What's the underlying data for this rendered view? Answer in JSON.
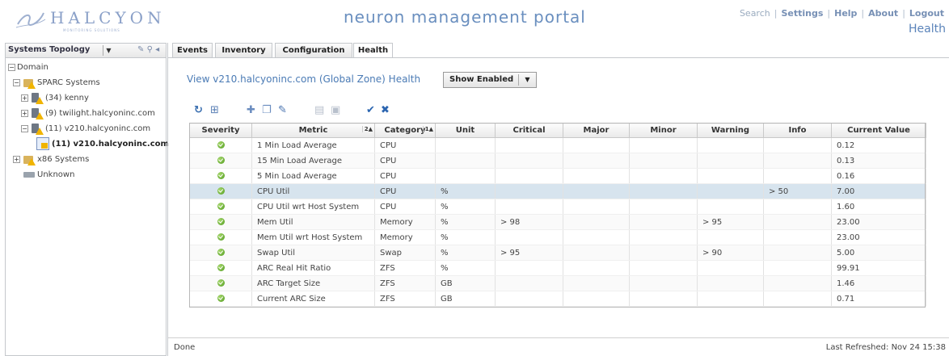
{
  "header": {
    "logo_text": "HALCYON",
    "logo_sub": "MONITORING SOLUTIONS",
    "portal_title": "neuron management portal",
    "links": [
      "Search",
      "Settings",
      "Help",
      "About",
      "Logout"
    ],
    "page_label": "Health",
    "colors": {
      "title": "#6a8fbf",
      "links": "#7790b5"
    }
  },
  "sidebar": {
    "title": "Systems Topology",
    "tree": [
      {
        "label": "Domain",
        "toggle": "⊟",
        "icon": "none"
      },
      {
        "label": "SPARC Systems",
        "toggle": "⊟",
        "icon": "folder-warning-icon"
      },
      {
        "label": "(34) kenny",
        "toggle": "⊞",
        "icon": "server-warning-icon"
      },
      {
        "label": "(9) twilight.halcyoninc.com",
        "toggle": "⊞",
        "icon": "server-warning-icon"
      },
      {
        "label": "(11) v210.halcyoninc.com",
        "toggle": "⊟",
        "icon": "server-warning-icon"
      },
      {
        "label": "(11) v210.halcyoninc.com",
        "toggle": "",
        "icon": "zone-warning-icon",
        "selected": true
      },
      {
        "label": "x86 Systems",
        "toggle": "⊞",
        "icon": "folder-warning-icon"
      },
      {
        "label": "Unknown",
        "toggle": "",
        "icon": "unknown-host-icon"
      }
    ]
  },
  "tabs": [
    {
      "label": "Events",
      "active": false
    },
    {
      "label": "Inventory",
      "active": false
    },
    {
      "label": "Configuration",
      "active": false
    },
    {
      "label": "Health",
      "active": true
    }
  ],
  "view": {
    "title": "View v210.halcyoninc.com (Global Zone) Health",
    "filter_value": "Show Enabled"
  },
  "toolbar": {
    "icons": [
      "refresh-icon",
      "export-icon",
      "add-icon",
      "copy-icon",
      "edit-icon",
      "import-icon",
      "save-icon",
      "enable-icon",
      "disable-icon"
    ]
  },
  "table": {
    "columns": [
      {
        "label": "Severity",
        "sort": ""
      },
      {
        "label": "Metric",
        "sort": "2▲"
      },
      {
        "label": "Category",
        "sort": "1▲"
      },
      {
        "label": "Unit",
        "sort": ""
      },
      {
        "label": "Critical",
        "sort": ""
      },
      {
        "label": "Major",
        "sort": ""
      },
      {
        "label": "Minor",
        "sort": ""
      },
      {
        "label": "Warning",
        "sort": ""
      },
      {
        "label": "Info",
        "sort": ""
      },
      {
        "label": "Current Value",
        "sort": ""
      }
    ],
    "rows": [
      {
        "severity": "ok",
        "metric": "1 Min Load Average",
        "category": "CPU",
        "unit": "",
        "critical": "",
        "major": "",
        "minor": "",
        "warning": "",
        "info": "",
        "value": "0.12"
      },
      {
        "severity": "ok",
        "metric": "15 Min Load Average",
        "category": "CPU",
        "unit": "",
        "critical": "",
        "major": "",
        "minor": "",
        "warning": "",
        "info": "",
        "value": "0.13"
      },
      {
        "severity": "ok",
        "metric": "5 Min Load Average",
        "category": "CPU",
        "unit": "",
        "critical": "",
        "major": "",
        "minor": "",
        "warning": "",
        "info": "",
        "value": "0.16"
      },
      {
        "severity": "ok",
        "metric": "CPU Util",
        "category": "CPU",
        "unit": "%",
        "critical": "",
        "major": "",
        "minor": "",
        "warning": "",
        "info": "> 50",
        "value": "7.00",
        "selected": true
      },
      {
        "severity": "ok",
        "metric": "CPU Util wrt Host System",
        "category": "CPU",
        "unit": "%",
        "critical": "",
        "major": "",
        "minor": "",
        "warning": "",
        "info": "",
        "value": "1.60"
      },
      {
        "severity": "ok",
        "metric": "Mem Util",
        "category": "Memory",
        "unit": "%",
        "critical": "> 98",
        "major": "",
        "minor": "",
        "warning": "> 95",
        "info": "",
        "value": "23.00"
      },
      {
        "severity": "ok",
        "metric": "Mem Util wrt Host System",
        "category": "Memory",
        "unit": "%",
        "critical": "",
        "major": "",
        "minor": "",
        "warning": "",
        "info": "",
        "value": "23.00"
      },
      {
        "severity": "ok",
        "metric": "Swap Util",
        "category": "Swap",
        "unit": "%",
        "critical": "> 95",
        "major": "",
        "minor": "",
        "warning": "> 90",
        "info": "",
        "value": "5.00"
      },
      {
        "severity": "ok",
        "metric": "ARC Real Hit Ratio",
        "category": "ZFS",
        "unit": "%",
        "critical": "",
        "major": "",
        "minor": "",
        "warning": "",
        "info": "",
        "value": "99.91"
      },
      {
        "severity": "ok",
        "metric": "ARC Target Size",
        "category": "ZFS",
        "unit": "GB",
        "critical": "",
        "major": "",
        "minor": "",
        "warning": "",
        "info": "",
        "value": "1.46"
      },
      {
        "severity": "ok",
        "metric": "Current ARC Size",
        "category": "ZFS",
        "unit": "GB",
        "critical": "",
        "major": "",
        "minor": "",
        "warning": "",
        "info": "",
        "value": "0.71"
      }
    ]
  },
  "status": {
    "left": "Done",
    "right": "Last Refreshed: Nov 24 15:38"
  }
}
